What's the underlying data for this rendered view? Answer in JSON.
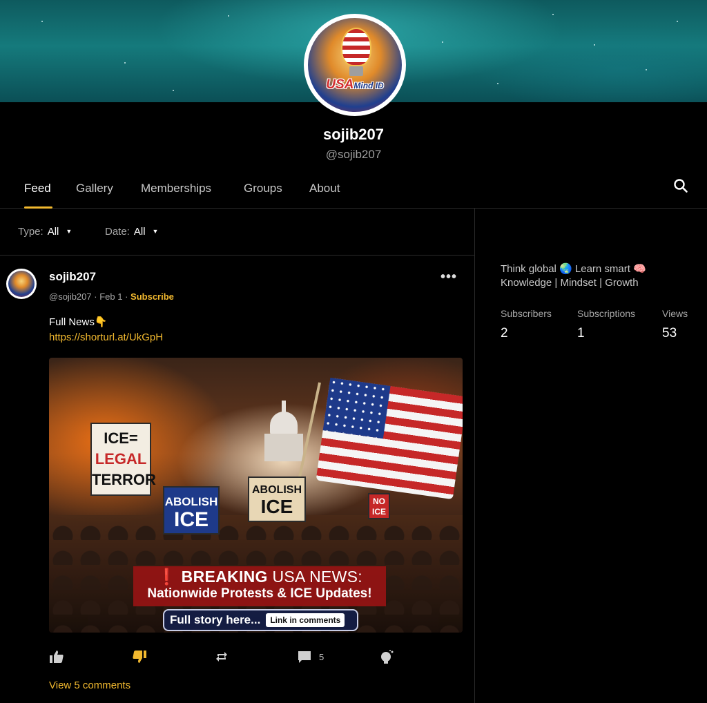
{
  "channel": {
    "name": "sojib207",
    "handle": "@sojib207",
    "logo_text_main": "USA",
    "logo_text_small": "Mind ID"
  },
  "tabs": [
    {
      "label": "Feed",
      "active": true
    },
    {
      "label": "Gallery",
      "active": false
    },
    {
      "label": "Memberships",
      "active": false
    },
    {
      "label": "Groups",
      "active": false
    },
    {
      "label": "About",
      "active": false
    }
  ],
  "filters": {
    "type_label": "Type:",
    "type_value": "All",
    "date_label": "Date:",
    "date_value": "All"
  },
  "post": {
    "author": "sojib207",
    "meta_handle": "@sojib207",
    "meta_date": "Feb 1",
    "subscribe_label": "Subscribe",
    "text": "Full News👇",
    "link": "https://shorturl.at/UkGpH",
    "image": {
      "sign_1_line1": "ICE=",
      "sign_1_line2": "LEGAL",
      "sign_1_line3": "TERROR",
      "sign_2_line1": "ABOLISH",
      "sign_2_line2": "ICE",
      "sign_3_line1": "ABOLISH",
      "sign_3_line2": "ICE",
      "sign_4": "NO ICE",
      "headline_strong": "BREAKING",
      "headline_rest": "USA NEWS:",
      "subheadline": "Nationwide Protests & ICE Updates!",
      "pill_text": "Full story here...",
      "pill_badge": "Link in comments"
    },
    "comment_count": "5",
    "view_comments": "View 5 comments"
  },
  "about": {
    "line1": "Think global 🌏 Learn smart 🧠",
    "line2": "Knowledge | Mindset | Growth",
    "stats": [
      {
        "label": "Subscribers",
        "value": "2"
      },
      {
        "label": "Subscriptions",
        "value": "1"
      },
      {
        "label": "Views",
        "value": "53"
      }
    ]
  },
  "colors": {
    "accent": "#f2b92f",
    "background": "#000000",
    "divider": "#2a2a2a"
  },
  "icons": [
    "search-icon",
    "more-icon",
    "thumbs-up-icon",
    "thumbs-down-icon",
    "repost-icon",
    "comment-icon",
    "tip-icon"
  ]
}
